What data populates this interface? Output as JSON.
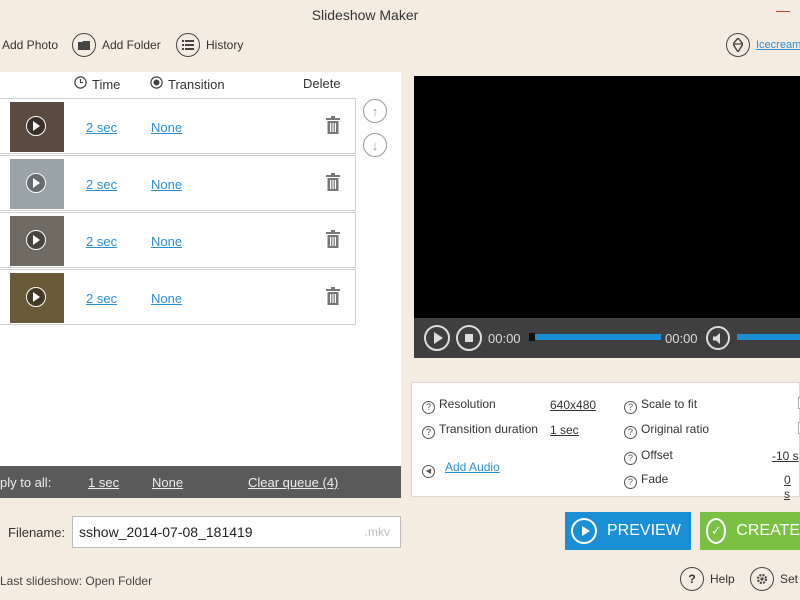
{
  "window": {
    "title": "Slideshow Maker",
    "close_glyph": "✕"
  },
  "toolbar": {
    "add_photo": "Add Photo",
    "add_folder": "Add Folder",
    "history": "History",
    "brand": "Icecream"
  },
  "queue": {
    "columns": {
      "time": "Time",
      "transition": "Transition",
      "delete": "Delete"
    },
    "rows": [
      {
        "time": "2 sec",
        "transition": "None",
        "thumb_color": "#5b4a3f"
      },
      {
        "time": "2 sec",
        "transition": "None",
        "thumb_color": "#9aa3a8"
      },
      {
        "time": "2 sec",
        "transition": "None",
        "thumb_color": "#6f6a62"
      },
      {
        "time": "2 sec",
        "transition": "None",
        "thumb_color": "#6a5a3a"
      }
    ],
    "apply_all": {
      "label": "ply to all:",
      "time": "1 sec",
      "transition": "None",
      "clear": "Clear queue (4)"
    }
  },
  "player": {
    "time_start": "00:00",
    "time_end": "00:00",
    "progress": 0
  },
  "settings": {
    "resolution_label": "Resolution",
    "resolution_value": "640x480",
    "transition_duration_label": "Transition duration",
    "transition_duration_value": "1 sec",
    "add_audio": "Add Audio",
    "scale_to_fit": "Scale to fit",
    "original_ratio": "Original ratio",
    "offset_label": "Offset",
    "offset_value": "-10 s",
    "fade_label": "Fade",
    "fade_value": "0 s"
  },
  "file": {
    "label": "Filename:",
    "value": "sshow_2014-07-08_181419",
    "extension": ".mkv"
  },
  "actions": {
    "preview": "PREVIEW",
    "create": "CREATE"
  },
  "footer": {
    "last_slideshow": "Last slideshow: Open Folder",
    "help": "Help",
    "settings": "Set"
  },
  "colors": {
    "background": "#f4ece0",
    "link": "#2a8fd6",
    "preview_button": "#1a8fd6",
    "create_button": "#7ac143",
    "apply_bar": "#5a5a5a"
  }
}
